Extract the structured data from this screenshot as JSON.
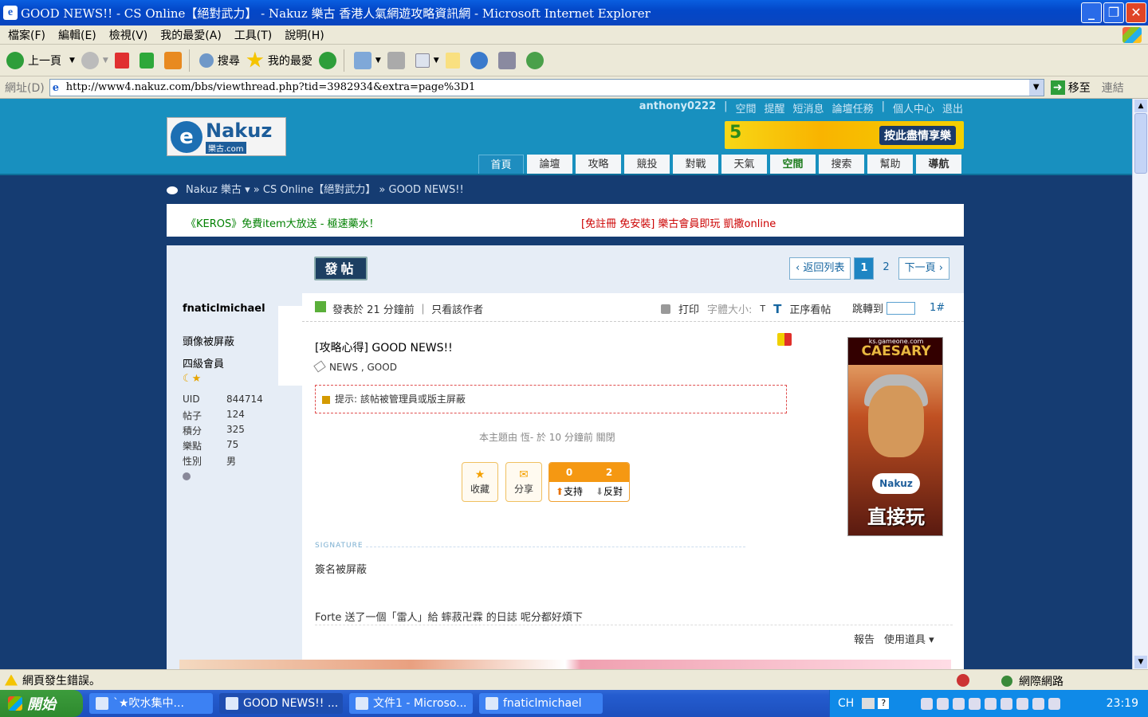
{
  "window": {
    "title": "GOOD NEWS!! - CS Online【絕對武力】 - Nakuz 樂古 香港人氣網遊攻略資訊網 - Microsoft Internet Explorer"
  },
  "menu": [
    "檔案(F)",
    "編輯(E)",
    "檢視(V)",
    "我的最愛(A)",
    "工具(T)",
    "說明(H)"
  ],
  "toolbar": {
    "back": "上一頁",
    "search": "搜尋",
    "favorites": "我的最愛"
  },
  "address": {
    "label": "網址(D)",
    "url": "http://www4.nakuz.com/bbs/viewthread.php?tid=3982934&extra=page%3D1",
    "go": "移至",
    "links": "連結"
  },
  "site": {
    "user_nav": [
      "anthony0222",
      "|",
      "空間",
      "提醒",
      "短消息",
      "論壇任務",
      "|",
      "個人中心",
      "退出"
    ],
    "logo_text": "Nakuz",
    "logo_sub": "樂古.com",
    "banner_badge": "5",
    "banner_text": "按此盡情享樂",
    "nav_tabs": [
      "首頁",
      "論壇",
      "攻略",
      "競投",
      "對戰",
      "天氣",
      "空間",
      "搜索",
      "幫助",
      "導航"
    ],
    "breadcrumb": "Nakuz 樂古 ▾  » CS Online【絕對武力】 » GOOD NEWS!!",
    "ad_left": "《KEROS》免費item大放送 - 極速藥水！",
    "ad_right": "[免註冊 免安裝] 樂古會員即玩 凱撒online"
  },
  "user": {
    "name": "fnaticlmichael",
    "avatar_note": "頭像被屏蔽",
    "level": "四級會員",
    "stars": "☾★",
    "stats": [
      {
        "k": "UID",
        "v": "844714"
      },
      {
        "k": "帖子",
        "v": "124"
      },
      {
        "k": "積分",
        "v": "325"
      },
      {
        "k": "樂點",
        "v": "75"
      },
      {
        "k": "性別",
        "v": "男"
      }
    ]
  },
  "thread": {
    "post_button": "發帖",
    "pager": [
      "‹ 返回列表",
      "1",
      "2",
      "下一頁 ›"
    ],
    "posted": "發表於 21 分鐘前 ｜ 只看該作者",
    "print": "打印",
    "fontsize": "字體大小:",
    "fontsize_t": "T",
    "fontsize_T": "T",
    "order": "正序看帖",
    "jump": "跳轉到",
    "floor": "1#",
    "title": "[攻略心得] GOOD NEWS!!",
    "tags": [
      "NEWS",
      "GOOD"
    ],
    "notice": "提示: 該帖被管理員或版主屏蔽",
    "closed": "本主題由 恆- 於 10 分鐘前 關閉",
    "favorite": "收藏",
    "share": "分享",
    "support_count": "0",
    "oppose_count": "2",
    "support": "支持",
    "oppose": "反對",
    "signature_label": "SIGNATURE",
    "signature": "簽名被屏蔽",
    "gift": "Forte 送了一個「雷人」給 蟀菽卍霖 的日誌 呢分都好煩下",
    "report": "報告",
    "use_tool": "使用道具 ▾"
  },
  "side_ad": {
    "site": "ks.gameone.com",
    "title": "CAESARY",
    "play": "直接玩",
    "logo": "Nakuz"
  },
  "status": {
    "text": "網頁發生錯誤。",
    "zone": "網際網路"
  },
  "taskbar": {
    "start": "開始",
    "tasks": [
      "`★吹水集中...",
      "GOOD NEWS!! ...",
      "文件1 - Microso...",
      "fnaticlmichael"
    ],
    "lang": "CH",
    "clock": "23:19"
  }
}
